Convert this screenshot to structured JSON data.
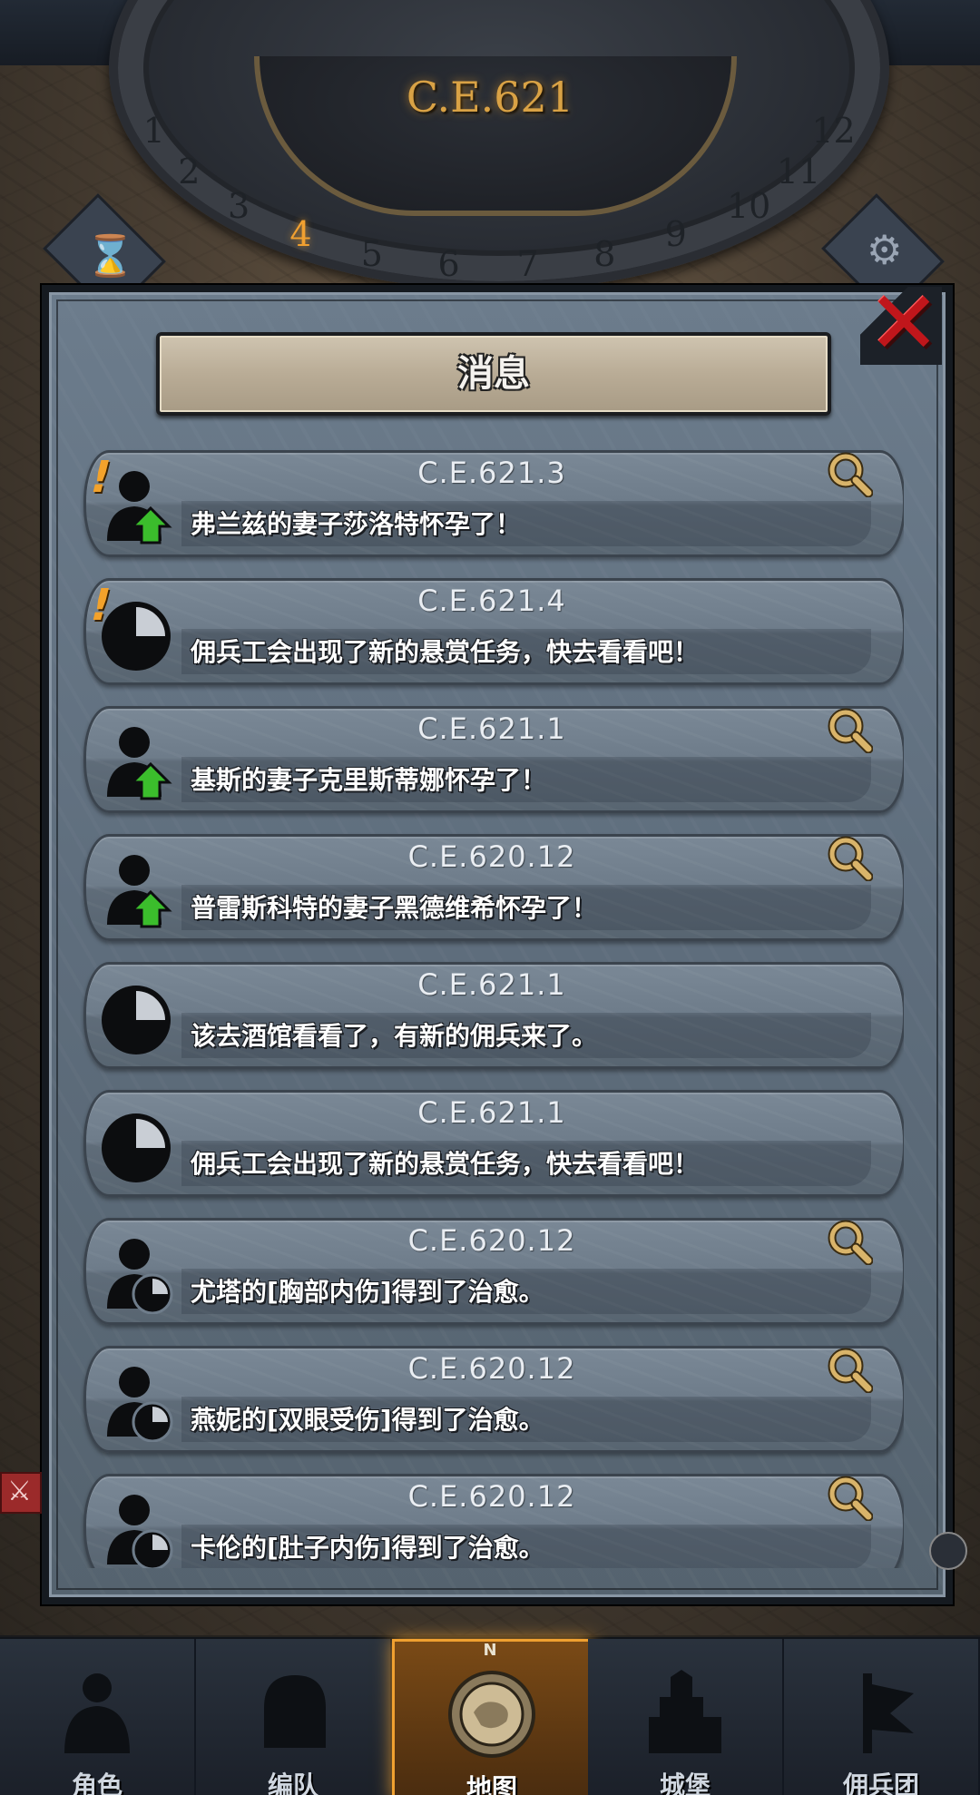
{
  "dial": {
    "year": "C.E.621",
    "months": [
      "1",
      "2",
      "3",
      "4",
      "5",
      "6",
      "7",
      "8",
      "9",
      "10",
      "11",
      "12"
    ],
    "active_month": "4"
  },
  "dialog": {
    "title": "消息",
    "close_icon": "close-icon"
  },
  "messages": [
    {
      "date": "C.E.621.3",
      "text": "弗兰兹的妻子莎洛特怀孕了！",
      "icon": "person-up-icon",
      "alert": "!",
      "searchable": true
    },
    {
      "date": "C.E.621.4",
      "text": "佣兵工会出现了新的悬赏任务，快去看看吧！",
      "icon": "clock-icon",
      "alert": "!",
      "searchable": false
    },
    {
      "date": "C.E.621.1",
      "text": "基斯的妻子克里斯蒂娜怀孕了！",
      "icon": "person-up-icon",
      "alert": "",
      "searchable": true
    },
    {
      "date": "C.E.620.12",
      "text": "普雷斯科特的妻子黑德维希怀孕了！",
      "icon": "person-up-icon",
      "alert": "",
      "searchable": true
    },
    {
      "date": "C.E.621.1",
      "text": "该去酒馆看看了，有新的佣兵来了。",
      "icon": "clock-icon",
      "alert": "",
      "searchable": false
    },
    {
      "date": "C.E.621.1",
      "text": "佣兵工会出现了新的悬赏任务，快去看看吧！",
      "icon": "clock-icon",
      "alert": "",
      "searchable": false
    },
    {
      "date": "C.E.620.12",
      "text": "尤塔的[胸部内伤]得到了治愈。",
      "icon": "person-clock-icon",
      "alert": "",
      "searchable": true
    },
    {
      "date": "C.E.620.12",
      "text": "燕妮的[双眼受伤]得到了治愈。",
      "icon": "person-clock-icon",
      "alert": "",
      "searchable": true
    },
    {
      "date": "C.E.620.12",
      "text": "卡伦的[肚子内伤]得到了治愈。",
      "icon": "person-clock-icon",
      "alert": "",
      "searchable": true
    }
  ],
  "nav": {
    "tabs": [
      {
        "label": "角色",
        "icon": "knight-icon"
      },
      {
        "label": "编队",
        "icon": "helmet-icon"
      },
      {
        "label": "地图",
        "icon": "compass-map-icon",
        "active": true
      },
      {
        "label": "城堡",
        "icon": "castle-icon"
      },
      {
        "label": "佣兵团",
        "icon": "banner-icon"
      }
    ],
    "compass_letter": "N"
  },
  "colors": {
    "accent": "#f0a030",
    "close": "#c0161b",
    "alert": "#f3a22b",
    "arrow_up": "#3bbd2c",
    "search": "#d9b46a"
  }
}
